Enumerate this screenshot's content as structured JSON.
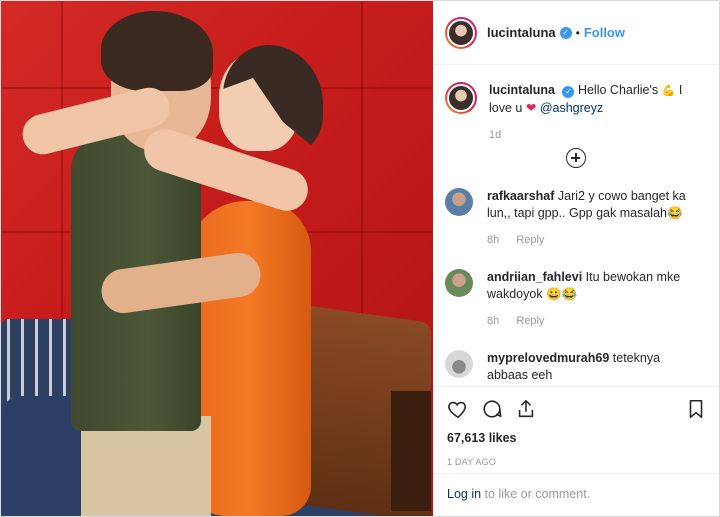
{
  "post": {
    "username": "lucintaluna",
    "follow_label": "Follow",
    "separator": "•"
  },
  "caption": {
    "username": "lucintaluna",
    "text_part1": "Hello Charlie's",
    "emoji1": "💪",
    "text_part2": "I love u",
    "emoji2": "❤",
    "mention": "@ashgreyz",
    "time": "1d"
  },
  "comments": [
    {
      "username": "rafkaarshaf",
      "text": "Jari2 y cowo banget ka lun,, tapi gpp.. Gpp gak masalah😂",
      "time": "8h",
      "reply": "Reply"
    },
    {
      "username": "andriian_fahlevi",
      "text": "Itu bewokan mke wakdoyok 😀😂",
      "time": "8h",
      "reply": "Reply"
    },
    {
      "username": "myprelovedmurah69",
      "text": "teteknya abbaas eeh",
      "time": "",
      "reply": ""
    }
  ],
  "stats": {
    "likes": "67,613 likes",
    "posted": "1 DAY AGO"
  },
  "login": {
    "link": "Log in",
    "rest": "to like or comment."
  },
  "colors": {
    "accent": "#3897f0",
    "link": "#003569",
    "muted": "#999999",
    "wall": "#c81d1d"
  },
  "icons": {
    "verified": "verified-badge-icon",
    "like": "heart-icon",
    "comment": "comment-icon",
    "share": "share-icon",
    "save": "bookmark-icon",
    "load_more": "plus-circle-icon"
  }
}
